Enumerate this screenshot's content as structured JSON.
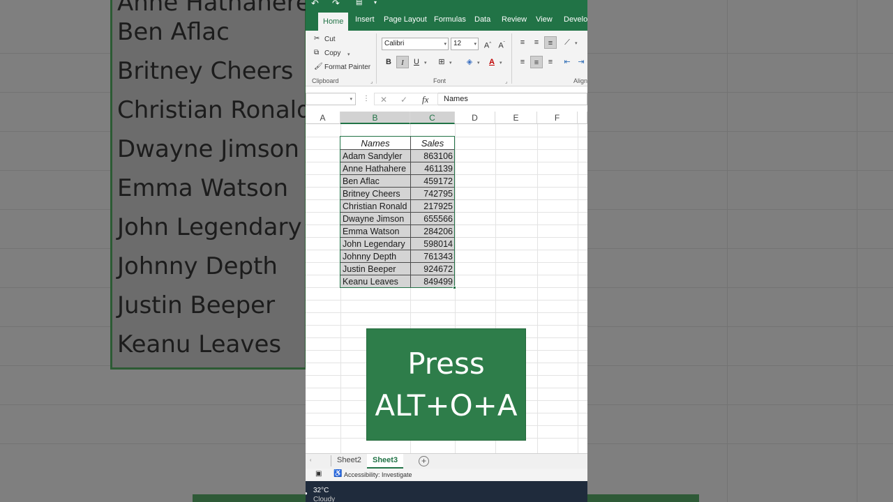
{
  "background_zoom": {
    "names": [
      "Anne Hathahere",
      "Ben Aflac",
      "Britney Cheers",
      "Christian Ronald",
      "Dwayne Jimson",
      "Emma Watson",
      "John Legendary",
      "Johnny Depth",
      "Justin Beeper",
      "Keanu Leaves"
    ]
  },
  "ribbon": {
    "tabs": [
      "Home",
      "Insert",
      "Page Layout",
      "Formulas",
      "Data",
      "Review",
      "View",
      "Develop"
    ],
    "active_tab": "Home",
    "clipboard": {
      "cut": "Cut",
      "copy": "Copy",
      "format_painter": "Format Painter",
      "group": "Clipboard"
    },
    "font": {
      "family": "Calibri",
      "size": "12",
      "group": "Font"
    },
    "alignment": {
      "group": "Align"
    }
  },
  "formula_bar": {
    "fx": "fx",
    "content": "Names"
  },
  "columns": [
    "A",
    "B",
    "C",
    "D",
    "E",
    "F"
  ],
  "table": {
    "headers": [
      "Names",
      "Sales"
    ],
    "rows": [
      [
        "Adam Sandyler",
        "863106"
      ],
      [
        "Anne Hathahere",
        "461139"
      ],
      [
        "Ben Aflac",
        "459172"
      ],
      [
        "Britney Cheers",
        "742795"
      ],
      [
        "Christian Ronald",
        "217925"
      ],
      [
        "Dwayne Jimson",
        "655566"
      ],
      [
        "Emma Watson",
        "284206"
      ],
      [
        "John Legendary",
        "598014"
      ],
      [
        "Johnny Depth",
        "761343"
      ],
      [
        "Justin Beeper",
        "924672"
      ],
      [
        "Keanu Leaves",
        "849499"
      ]
    ]
  },
  "overlay": {
    "line1": "Press",
    "line2": "ALT+O+A"
  },
  "sheets": {
    "tabs": [
      "Sheet2",
      "Sheet3"
    ],
    "active": "Sheet3",
    "add": "+"
  },
  "status": {
    "accessibility": "Accessibility: Investigate"
  },
  "taskbar": {
    "temp": "32°C",
    "weather": "Cloudy"
  },
  "colors": {
    "excel_green": "#217346",
    "overlay_green": "#2e7d4a"
  }
}
